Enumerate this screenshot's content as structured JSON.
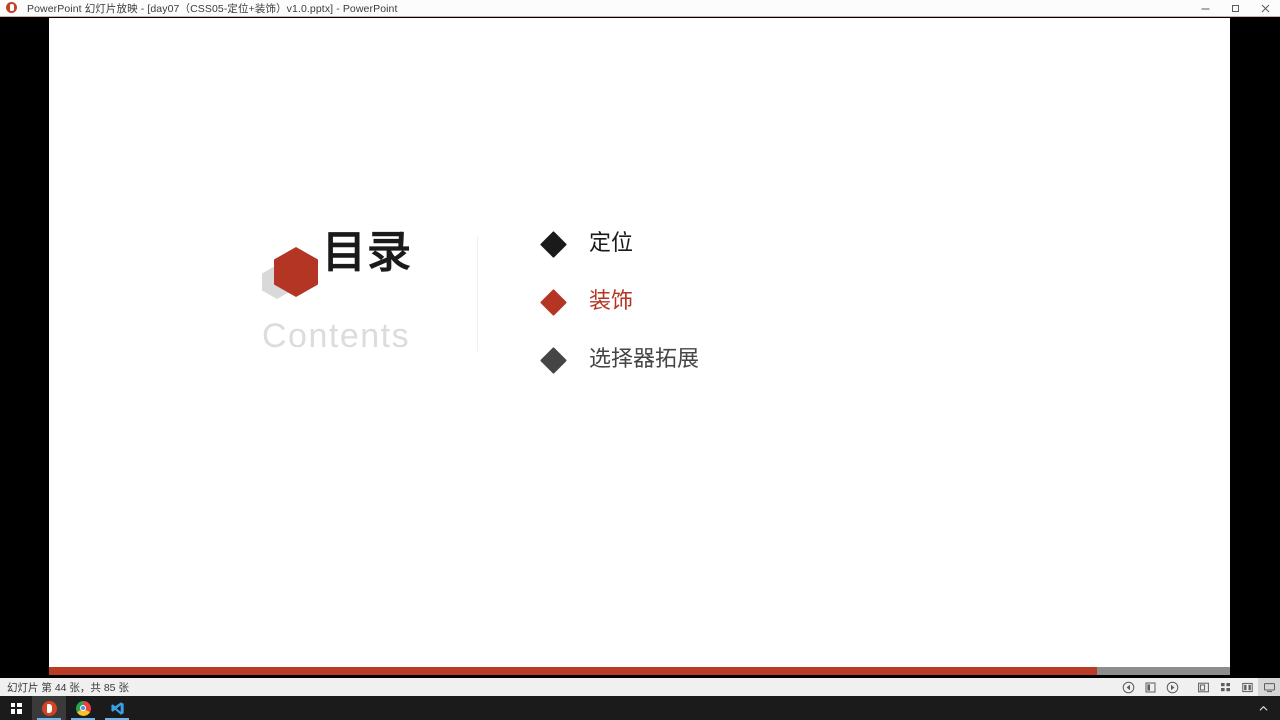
{
  "window": {
    "app_icon": "powerpoint-icon",
    "title": "PowerPoint 幻灯片放映  -  [day07（CSS05-定位+装饰）v1.0.pptx] - PowerPoint",
    "minimize_label": "minimize-icon",
    "restore_label": "restore-icon",
    "close_label": "close-icon"
  },
  "slide": {
    "heading_cn": "目录",
    "heading_en": "Contents",
    "logo": "hexagon-logo",
    "accent_color": "#b43524",
    "items": [
      {
        "label": "定位",
        "bullet_color": "#1a1a1a",
        "text_color": "#1a1a1a",
        "state": "normal"
      },
      {
        "label": "装饰",
        "bullet_color": "#b43524",
        "text_color": "#b43524",
        "state": "highlighted"
      },
      {
        "label": "选择器拓展",
        "bullet_color": "#454545",
        "text_color": "#454545",
        "state": "normal"
      }
    ]
  },
  "progress": {
    "percent": 88.7,
    "fill_color": "#b93c25",
    "track_color": "#8d8d8d"
  },
  "status": {
    "text": "幻灯片 第 44 张，共 85 张",
    "current_slide": 44,
    "total_slides": 85,
    "controls": [
      {
        "name": "previous-slide-button",
        "glyph": "◁"
      },
      {
        "name": "pointer-options-button",
        "glyph": "▮"
      },
      {
        "name": "next-slide-button",
        "glyph": "▷"
      }
    ],
    "view_controls": [
      {
        "name": "zoom-slide-button",
        "glyph": "zoom"
      },
      {
        "name": "all-slides-button",
        "glyph": "grid"
      },
      {
        "name": "reading-view-button",
        "glyph": "book"
      },
      {
        "name": "presenter-view-button",
        "glyph": "monitor",
        "active": true
      }
    ]
  },
  "taskbar": {
    "start_label": "start-button",
    "items": [
      {
        "name": "taskbar-item-powerpoint",
        "icon": "powerpoint-icon",
        "active": true
      },
      {
        "name": "taskbar-item-chrome",
        "icon": "chrome-icon",
        "active": false
      },
      {
        "name": "taskbar-item-vscode",
        "icon": "vscode-icon",
        "active": false
      }
    ],
    "tray_label": "show-hidden-icons-chevron"
  }
}
